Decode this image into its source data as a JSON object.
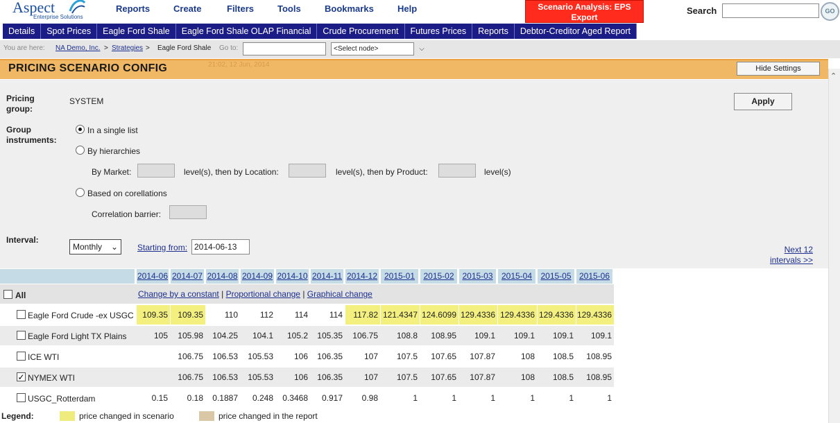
{
  "logo": {
    "name": "Aspect",
    "tagline": "Enterprise Solutions"
  },
  "menu": [
    "Reports",
    "Create",
    "Filters",
    "Tools",
    "Bookmarks",
    "Help"
  ],
  "scenario_button": {
    "line1": "Scenario Analysis: EPS",
    "line2": "Export"
  },
  "search": {
    "label": "Search",
    "go": "GO"
  },
  "tabs": [
    "Details",
    "Spot Prices",
    "Eagle Ford Shale",
    "Eagle Ford Shale OLAP Financial",
    "Crude Procurement",
    "Futures Prices",
    "Reports",
    "Debtor-Creditor Aged Report"
  ],
  "breadcrumb": {
    "prefix": "You are here:",
    "items": [
      "NA Demo, Inc.",
      "Strategies",
      "Eagle Ford Shale"
    ],
    "sep": ">",
    "goto_label": "Go to:",
    "select_placeholder": "<Select node>"
  },
  "header": {
    "title": "PRICING SCENARIO CONFIG",
    "timestamp": "21:02, 12 Jun, 2014",
    "hide_button": "Hide Settings"
  },
  "settings": {
    "pricing_group_label": "Pricing group:",
    "pricing_group_value": "SYSTEM",
    "apply": "Apply",
    "group_instruments_label": "Group instruments:",
    "opt_single": "In a single list",
    "opt_hierarchies": "By hierarchies",
    "by_market": "By Market:",
    "levels_location": "level(s), then by Location:",
    "levels_product": "level(s), then by Product:",
    "levels_end": "level(s)",
    "opt_correlations": "Based on corellations",
    "correlation_barrier": "Correlation barrier:",
    "interval_label": "Interval:",
    "interval_value": "Monthly",
    "starting_from_label": "Starting from:",
    "starting_from_value": "2014-06-13",
    "next_line1": "Next 12",
    "next_line2": "intervals >>"
  },
  "grid": {
    "all_label": "All",
    "actions": {
      "constant": "Change by a constant",
      "sep": "|",
      "proportional": "Proportional change",
      "graphical": "Graphical change"
    },
    "months": [
      "2014-06",
      "2014-07",
      "2014-08",
      "2014-09",
      "2014-10",
      "2014-11",
      "2014-12",
      "2015-01",
      "2015-02",
      "2015-03",
      "2015-04",
      "2015-05",
      "2015-06"
    ],
    "rows": [
      {
        "name": "Eagle Ford Crude -ex USGC",
        "checked": false,
        "values": [
          "109.35",
          "109.35",
          "110",
          "112",
          "114",
          "114",
          "117.82",
          "121.4347",
          "124.6099",
          "129.4336",
          "129.4336",
          "129.4336",
          "129.4336"
        ],
        "highlight": [
          true,
          true,
          false,
          false,
          false,
          false,
          true,
          true,
          true,
          true,
          true,
          true,
          true
        ]
      },
      {
        "name": "Eagle Ford Light TX Plains",
        "checked": false,
        "values": [
          "105",
          "105.98",
          "104.25",
          "104.1",
          "105.2",
          "105.35",
          "106.75",
          "108.8",
          "108.95",
          "109.1",
          "109.1",
          "109.1",
          "109.1"
        ]
      },
      {
        "name": "ICE WTI",
        "checked": false,
        "values": [
          "",
          "106.75",
          "106.53",
          "105.53",
          "106",
          "106.35",
          "107",
          "107.5",
          "107.65",
          "107.87",
          "108",
          "108.5",
          "108.95"
        ]
      },
      {
        "name": "NYMEX WTI",
        "checked": true,
        "values": [
          "",
          "106.75",
          "106.53",
          "105.53",
          "106",
          "106.35",
          "107",
          "107.5",
          "107.65",
          "107.87",
          "108",
          "108.5",
          "108.95"
        ]
      },
      {
        "name": "USGC_Rotterdam",
        "checked": false,
        "values": [
          "0.15",
          "0.18",
          "0.1887",
          "0.248",
          "0.3468",
          "0.917",
          "0.98",
          "1",
          "1",
          "1",
          "1",
          "1",
          "1"
        ]
      }
    ]
  },
  "legend": {
    "label": "Legend:",
    "scenario": "price changed in scenario",
    "report": "price changed in the report",
    "scenario_color": "#eeec7e",
    "report_color": "#d9c7a6"
  },
  "colors": {
    "highlight": "#f3f07f",
    "row_even": "#ebebeb",
    "row_odd": "#ffffff",
    "header_col": "#c5dbe6",
    "tabbar": "#1c1c86"
  }
}
